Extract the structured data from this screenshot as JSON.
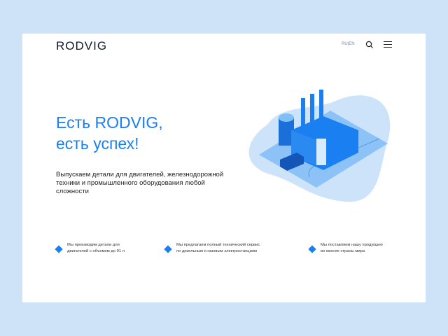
{
  "header": {
    "logo": "RODVIG",
    "lang_ru": "RU",
    "lang_sep": "|",
    "lang_en": "EN"
  },
  "hero": {
    "title_line1": "Есть RODVIG,",
    "title_line2": "есть успех!",
    "description": "Выпускаем детали для двигателей, железнодорожной  техники и промышленного оборудования любой  сложности"
  },
  "features": [
    {
      "line1": "Мы производим детали для",
      "line2": "двигателей с объемом до 91 л"
    },
    {
      "line1": "Мы предлагаем полный технический сервис",
      "line2": "по дизельным и газовым электростанциям"
    },
    {
      "line1": "Мы поставляем нашу продукцию",
      "line2": "во многие страны мира"
    }
  ],
  "colors": {
    "accent": "#1a7ff0",
    "background": "#cfe3f8"
  }
}
